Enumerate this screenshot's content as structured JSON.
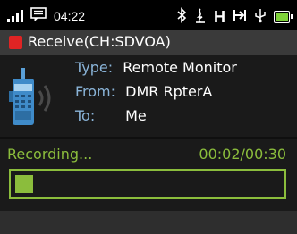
{
  "status_bar": {
    "time": "04:22",
    "icons": [
      "signal-icon",
      "message-icon",
      "bluetooth-icon",
      "scan-icon",
      "h-icon",
      "route-icon",
      "usb-icon",
      "battery-icon"
    ],
    "h_glyph": "H",
    "battery_color": "#7fd23a"
  },
  "title": {
    "text": "Receive(CH:SDVOA)",
    "indicator_color": "#e02424"
  },
  "call_info": {
    "type_label": "Type:",
    "type_value": "Remote Monitor",
    "from_label": "From:",
    "from_value": "DMR RpterA",
    "to_label": "To:",
    "to_value": "Me",
    "label_color": "#8ab4d8"
  },
  "recording": {
    "label": "Recording...",
    "time": "00:02/00:30",
    "progress_fraction": 0.067,
    "accent_color": "#8bbd3c"
  }
}
